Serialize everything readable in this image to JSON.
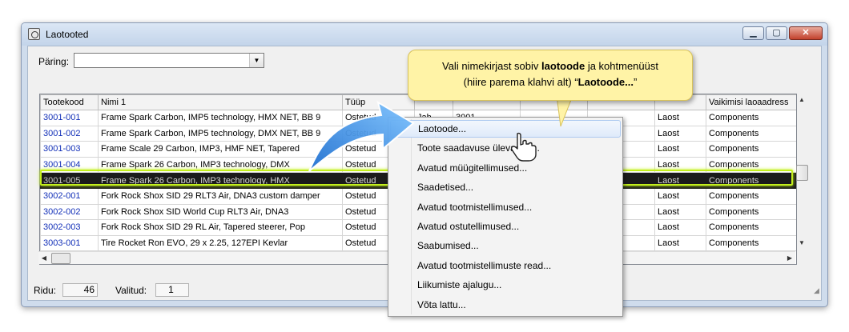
{
  "window": {
    "title": "Laotooted"
  },
  "query": {
    "label": "Päring:",
    "value": ""
  },
  "grid": {
    "columns": [
      "Tootekood",
      "Nimi 1",
      "Tüüp",
      "",
      "",
      "",
      "",
      "",
      "Vaikimisi laoaadress"
    ],
    "rows": [
      {
        "code": "3001-001",
        "name": "Frame Spark Carbon, IMP5 technology, HMX NET, BB 9",
        "type": "Ostetud",
        "c4": "Jah",
        "c5": "3001",
        "c6": "",
        "c7": "",
        "c8": "Laost",
        "addr": "Components"
      },
      {
        "code": "3001-002",
        "name": "Frame Spark Carbon, IMP5 technology, DMX NET, BB 9",
        "type": "Ostetud",
        "c4": "",
        "c5": "",
        "c6": "",
        "c7": "",
        "c8": "Laost",
        "addr": "Components"
      },
      {
        "code": "3001-003",
        "name": "Frame Scale 29 Carbon, IMP3, HMF NET, Tapered",
        "type": "Ostetud",
        "c4": "",
        "c5": "",
        "c6": "",
        "c7": "",
        "c8": "Laost",
        "addr": "Components"
      },
      {
        "code": "3001-004",
        "name": "Frame Spark 26 Carbon, IMP3 technology, DMX",
        "type": "Ostetud",
        "c4": "",
        "c5": "",
        "c6": "",
        "c7": "",
        "c8": "Laost",
        "addr": "Components"
      },
      {
        "code": "3001-005",
        "name": "Frame Spark 26 Carbon, IMP3 technology, HMX",
        "type": "Ostetud",
        "c4": "",
        "c5": "",
        "c6": "",
        "c7": "",
        "c8": "Laost",
        "addr": "Components"
      },
      {
        "code": "3002-001",
        "name": "Fork Rock Shox SID 29 RLT3 Air, DNA3 custom damper",
        "type": "Ostetud",
        "c4": "",
        "c5": "",
        "c6": "",
        "c7": "",
        "c8": "Laost",
        "addr": "Components"
      },
      {
        "code": "3002-002",
        "name": "Fork Rock Shox SID World Cup RLT3 Air, DNA3",
        "type": "Ostetud",
        "c4": "",
        "c5": "",
        "c6": "",
        "c7": "",
        "c8": "Laost",
        "addr": "Components"
      },
      {
        "code": "3002-003",
        "name": "Fork Rock Shox SID 29 RL Air, Tapered steerer, Pop",
        "type": "Ostetud",
        "c4": "",
        "c5": "",
        "c6": "",
        "c7": "",
        "c8": "Laost",
        "addr": "Components"
      },
      {
        "code": "3003-001",
        "name": "Tire Rocket Ron EVO, 29 x 2.25, 127EPI Kevlar",
        "type": "Ostetud",
        "c4": "",
        "c5": "",
        "c6": "",
        "c7": "",
        "c8": "Laost",
        "addr": "Components"
      }
    ],
    "selected_code": "3001-005"
  },
  "status": {
    "rows_label": "Ridu:",
    "rows_value": "46",
    "selected_label": "Valitud:",
    "selected_value": "1"
  },
  "context_menu": {
    "items": [
      "Laotoode...",
      "Toote saadavuse ülevaade...",
      "Avatud müügitellimused...",
      "Saadetised...",
      "Avatud tootmistellimused...",
      "Avatud ostutellimused...",
      "Saabumised...",
      "Avatud tootmistellimuste read...",
      "Liikumiste ajalugu...",
      "Võta lattu..."
    ],
    "highlighted": "Laotoode..."
  },
  "callout": {
    "line1_prefix": "Vali nimekirjast sobiv ",
    "line1_bold": "laotoode",
    "line1_suffix": " ja kohtmenüüst",
    "line2_prefix": "(hiire parema klahvi alt) “",
    "line2_bold": "Laotoode...",
    "line2_suffix": "”"
  },
  "colors": {
    "highlight": "#c3ef1c",
    "callout_bg": "#fff3a6",
    "code_link": "#1330b8",
    "selected_row": "#1b1b1b"
  }
}
